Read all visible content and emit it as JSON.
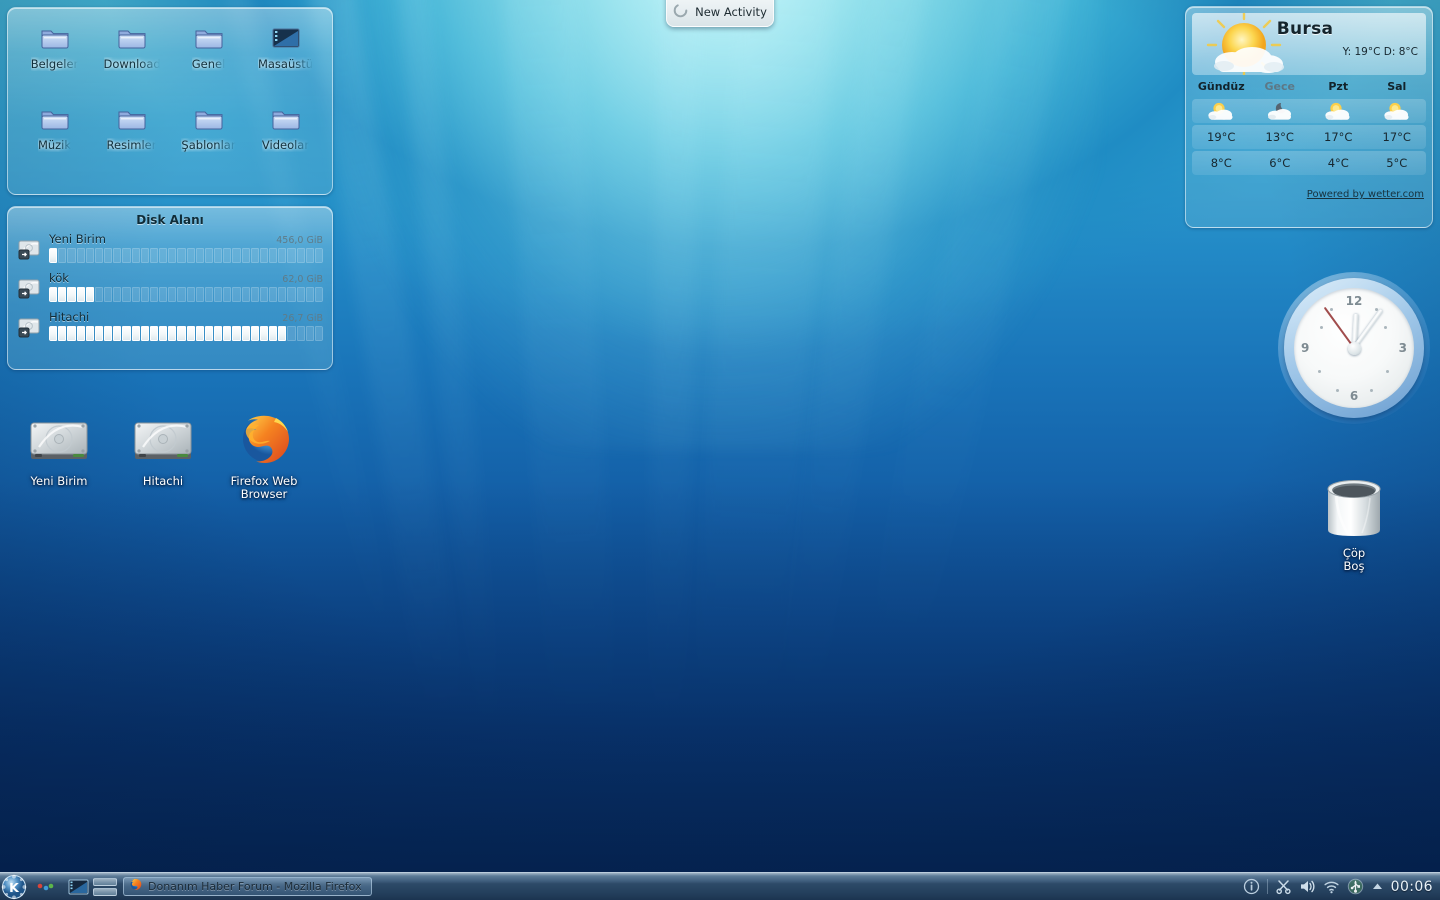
{
  "desktop": {
    "environment": "KDE Plasma",
    "accent_color": "#2d4a68",
    "wallpaper_top_color": "#46b9d8",
    "wallpaper_bottom_color": "#072e64"
  },
  "new_activity": {
    "label": "New Activity",
    "icon": "activity-circle-icon"
  },
  "folder_view": {
    "items": [
      {
        "label": "Belgeler",
        "icon": "folder-icon"
      },
      {
        "label": "Downloads",
        "icon": "folder-icon"
      },
      {
        "label": "Genel",
        "icon": "folder-icon"
      },
      {
        "label": "Masaüstü",
        "icon": "desktop-icon"
      },
      {
        "label": "Müzik",
        "icon": "folder-icon"
      },
      {
        "label": "Resimler",
        "icon": "folder-icon"
      },
      {
        "label": "Şablonlar",
        "icon": "folder-icon"
      },
      {
        "label": "Videolar",
        "icon": "folder-icon"
      }
    ]
  },
  "disk_space": {
    "title": "Disk Alanı",
    "segments_total": 30,
    "drives": [
      {
        "name": "Yeni Birim",
        "size": "456,0 GiB",
        "filled_segments": 1,
        "icon": "hard-drive-icon"
      },
      {
        "name": "kök",
        "size": "62,0 GiB",
        "filled_segments": 5,
        "icon": "hard-drive-icon"
      },
      {
        "name": "Hitachi",
        "size": "26,7 GiB",
        "filled_segments": 26,
        "icon": "hard-drive-icon"
      }
    ]
  },
  "weather": {
    "city": "Bursa",
    "current_summary": "Y: 19°C D: 8°C",
    "main_icon": "sun-behind-cloud-icon",
    "columns": [
      {
        "day": "Gündüz",
        "icon": "sun-behind-cloud-icon",
        "high": "19°C",
        "low": "8°C",
        "dim": false
      },
      {
        "day": "Gece",
        "icon": "moon-behind-cloud-icon",
        "high": "13°C",
        "low": "6°C",
        "dim": true
      },
      {
        "day": "Pzt",
        "icon": "sun-behind-cloud-icon",
        "high": "17°C",
        "low": "4°C",
        "dim": false
      },
      {
        "day": "Sal",
        "icon": "sun-behind-cloud-icon",
        "high": "17°C",
        "low": "5°C",
        "dim": false
      }
    ],
    "credit": "Powered by wetter.com"
  },
  "analog_clock": {
    "numerals": [
      "12",
      "3",
      "6",
      "9"
    ],
    "hour_angle_deg": 3,
    "minute_angle_deg": 36,
    "second_angle_deg": 324,
    "time_shown": "00:06"
  },
  "desktop_icons": [
    {
      "label": "Yeni Birim",
      "icon": "hard-drive-icon"
    },
    {
      "label": "Hitachi",
      "icon": "hard-drive-icon"
    },
    {
      "label": "Firefox Web Browser",
      "icon": "firefox-icon"
    },
    {
      "label_line1": "Çöp",
      "label_line2": "Boş",
      "icon": "trash-empty-icon"
    }
  ],
  "panel": {
    "kmenu_icon": "kde-k-menu-icon",
    "launchers": [
      {
        "icon": "activity-dots-icon"
      },
      {
        "icon": "show-desktop-icon"
      }
    ],
    "pager_icon": "pager-icon",
    "tasks": [
      {
        "title": "Donanım Haber Forum - Mozilla Firefox",
        "icon": "firefox-icon",
        "active": true
      }
    ],
    "tray": [
      {
        "icon": "info-icon"
      },
      {
        "icon": "scissors-klipper-icon"
      },
      {
        "icon": "volume-icon"
      },
      {
        "icon": "wifi-icon"
      },
      {
        "icon": "device-notifier-usb-icon"
      },
      {
        "icon": "expand-arrow-icon"
      }
    ],
    "clock": "00:06"
  }
}
